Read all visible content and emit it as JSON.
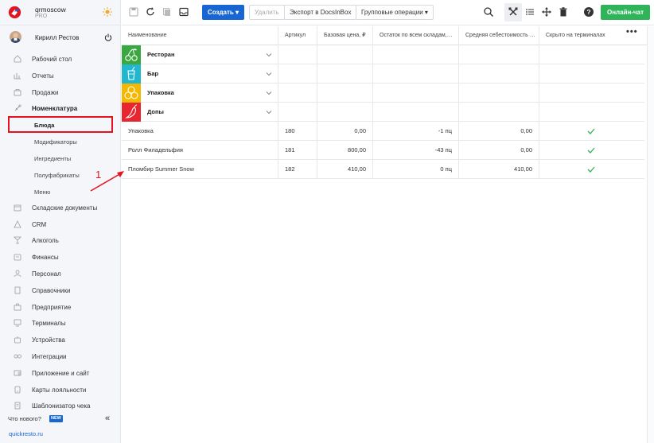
{
  "brand": {
    "org": "qrmoscow",
    "plan": "PRO"
  },
  "user": {
    "name": "Кирилл Рестов"
  },
  "nav": [
    {
      "label": "Рабочий стол",
      "icon": "home-icon"
    },
    {
      "label": "Отчеты",
      "icon": "reports-icon"
    },
    {
      "label": "Продажи",
      "icon": "sales-icon"
    },
    {
      "label": "Номенклатура",
      "icon": "nomenclature-icon"
    }
  ],
  "subnav": [
    {
      "label": "Блюда"
    },
    {
      "label": "Модификаторы"
    },
    {
      "label": "Ингредиенты"
    },
    {
      "label": "Полуфабрикаты"
    },
    {
      "label": "Меню"
    }
  ],
  "nav2": [
    {
      "label": "Складские документы",
      "icon": "warehouse-icon"
    },
    {
      "label": "CRM",
      "icon": "crm-icon"
    },
    {
      "label": "Алкоголь",
      "icon": "alcohol-icon"
    },
    {
      "label": "Финансы",
      "icon": "finance-icon"
    },
    {
      "label": "Персонал",
      "icon": "staff-icon"
    },
    {
      "label": "Справочники",
      "icon": "directory-icon"
    },
    {
      "label": "Предприятие",
      "icon": "enterprise-icon"
    },
    {
      "label": "Терминалы",
      "icon": "terminal-icon"
    },
    {
      "label": "Устройства",
      "icon": "devices-icon"
    },
    {
      "label": "Интеграции",
      "icon": "integrations-icon"
    },
    {
      "label": "Приложение и сайт",
      "icon": "app-icon"
    },
    {
      "label": "Карты лояльности",
      "icon": "loyalty-icon"
    },
    {
      "label": "Шаблонизатор чека",
      "icon": "receipt-icon"
    }
  ],
  "footer": {
    "whats_new": "Что нового?",
    "badge": "NEW",
    "collapse": "«",
    "site": "quickresto.ru"
  },
  "toolbar": {
    "create": "Создать",
    "delete": "Удалить",
    "export": "Экспорт в DocsInBox",
    "group_ops": "Групповые операции",
    "chat": "Онлайн-чат"
  },
  "columns": [
    "Наименование",
    "Артикул",
    "Базовая цена, ₽",
    "Остаток по всем складам,…",
    "Средняя себестоимость …",
    "Скрыто на терминалах"
  ],
  "more": "•••",
  "categories": [
    {
      "name": "Ресторан",
      "color": "#3aa83f",
      "icon": "cherry-icon"
    },
    {
      "name": "Бар",
      "color": "#21b7cf",
      "icon": "cocktail-icon"
    },
    {
      "name": "Упаковка",
      "color": "#f5b800",
      "icon": "circles-icon"
    },
    {
      "name": "Допы",
      "color": "#e8262f",
      "icon": "pepper-icon"
    }
  ],
  "items": [
    {
      "name": "Упаковка",
      "article": "180",
      "price": "0,00",
      "stock": "-1 пц",
      "cost": "0,00"
    },
    {
      "name": "Ролл Филадельфия",
      "article": "181",
      "price": "800,00",
      "stock": "-43 пц",
      "cost": "0,00"
    },
    {
      "name": "Пломбир Summer Snow",
      "article": "182",
      "price": "410,00",
      "stock": "0 пц",
      "cost": "410,00"
    }
  ],
  "annotation": {
    "number": "1"
  }
}
